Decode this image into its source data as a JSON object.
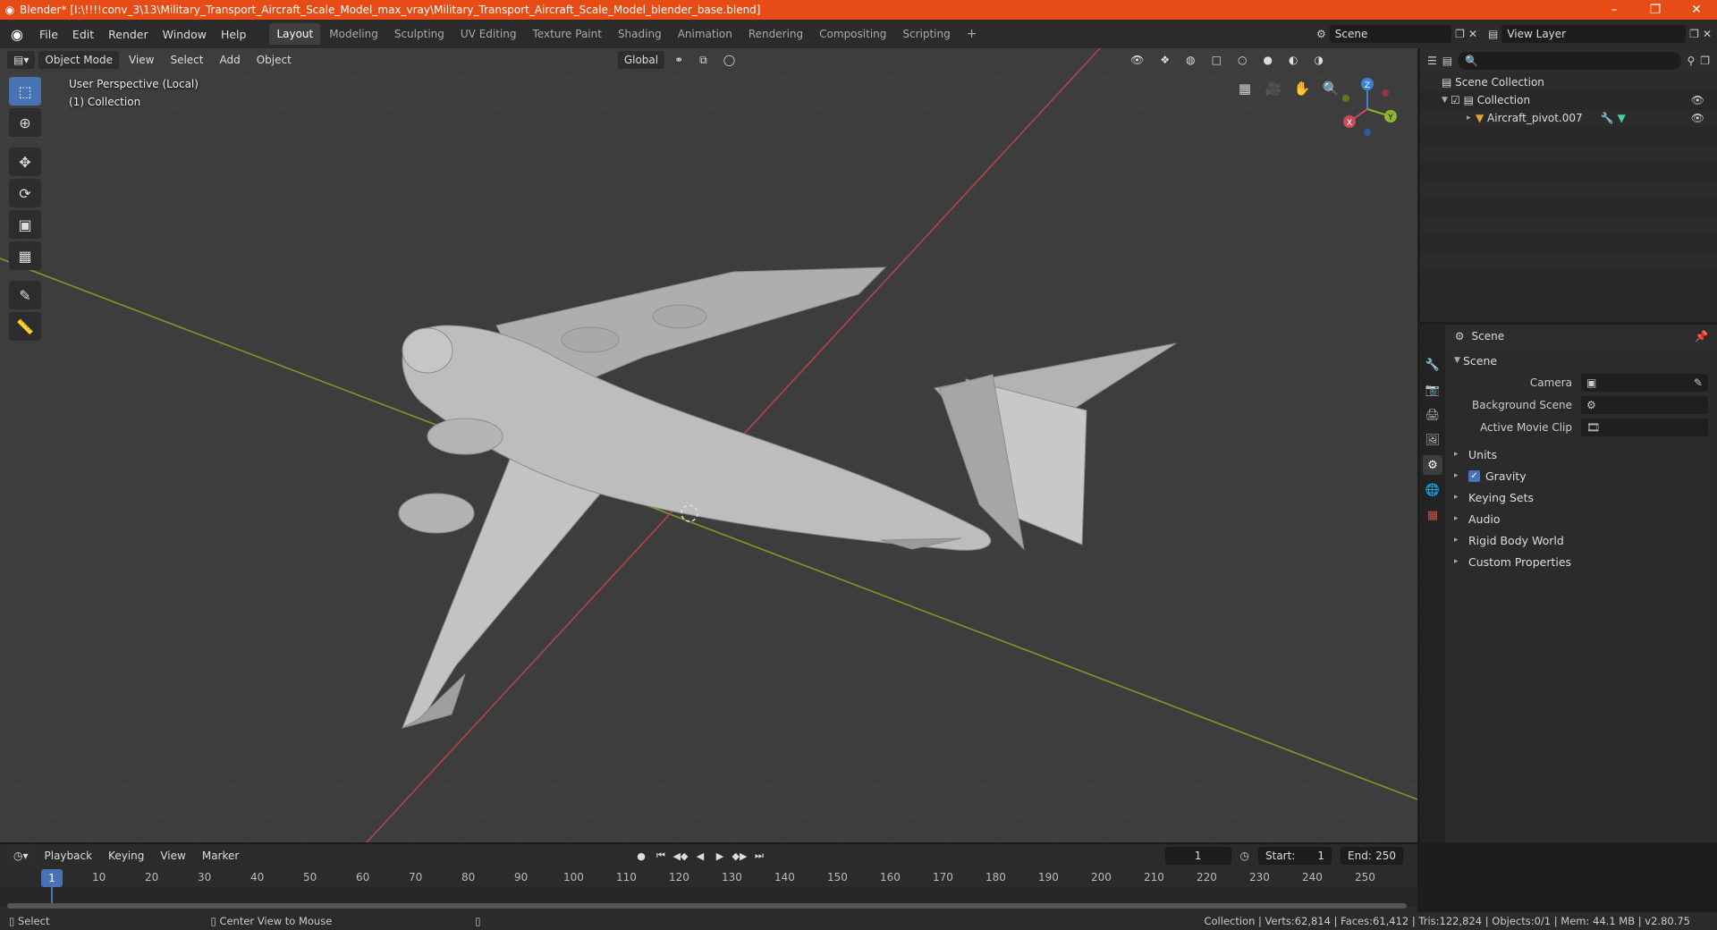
{
  "window": {
    "title": "Blender* [I:\\!!!!conv_3\\13\\Military_Transport_Aircraft_Scale_Model_max_vray\\Military_Transport_Aircraft_Scale_Model_blender_base.blend]",
    "minimize": "–",
    "maximize": "❐",
    "close": "✕"
  },
  "menubar": {
    "items": [
      "File",
      "Edit",
      "Render",
      "Window",
      "Help"
    ],
    "workspaces": [
      "Layout",
      "Modeling",
      "Sculpting",
      "UV Editing",
      "Texture Paint",
      "Shading",
      "Animation",
      "Rendering",
      "Compositing",
      "Scripting"
    ],
    "active_workspace": "Layout",
    "add_workspace": "+",
    "scene": "Scene",
    "view_layer": "View Layer"
  },
  "viewport": {
    "mode": "Object Mode",
    "menus": [
      "View",
      "Select",
      "Add",
      "Object"
    ],
    "transform_orientation": "Global",
    "info_line1": "User Perspective (Local)",
    "info_line2": "(1) Collection",
    "gizmo_axes": [
      "X",
      "Y",
      "Z"
    ],
    "tools": [
      "select-box",
      "cursor",
      "move",
      "rotate",
      "scale",
      "transform",
      "annotate",
      "measure"
    ]
  },
  "outliner": {
    "search_placeholder": "",
    "rows": [
      "Scene Collection",
      "Collection",
      "Aircraft_pivot.007"
    ]
  },
  "properties": {
    "context": "Scene",
    "panel": "Scene",
    "fields": [
      {
        "label": "Camera",
        "value": ""
      },
      {
        "label": "Background Scene",
        "value": ""
      },
      {
        "label": "Active Movie Clip",
        "value": ""
      }
    ],
    "subpanels": [
      "Units",
      "Gravity",
      "Keying Sets",
      "Audio",
      "Rigid Body World",
      "Custom Properties"
    ]
  },
  "timeline": {
    "menus": [
      "Playback",
      "Keying",
      "View",
      "Marker"
    ],
    "current_frame": "1",
    "start_label": "Start:",
    "start": "1",
    "end_label": "End:",
    "end": "250",
    "ruler_current": "1",
    "ticks": [
      "10",
      "20",
      "30",
      "40",
      "50",
      "60",
      "70",
      "80",
      "90",
      "100",
      "110",
      "120",
      "130",
      "140",
      "150",
      "160",
      "170",
      "180",
      "190",
      "200",
      "210",
      "220",
      "230",
      "240",
      "250"
    ]
  },
  "status": {
    "left_action": "Select",
    "mid_action": "Center View to Mouse",
    "right": "Collection | Verts:62,814 | Faces:61,412 | Tris:122,824 | Objects:0/1 | Mem: 44.1 MB | v2.80.75"
  },
  "colors": {
    "title_bar": "#e84c16",
    "accent": "#4772b3",
    "x_axis": "#c84b5a",
    "y_axis": "#8fb432",
    "z_axis": "#3b82d6"
  }
}
